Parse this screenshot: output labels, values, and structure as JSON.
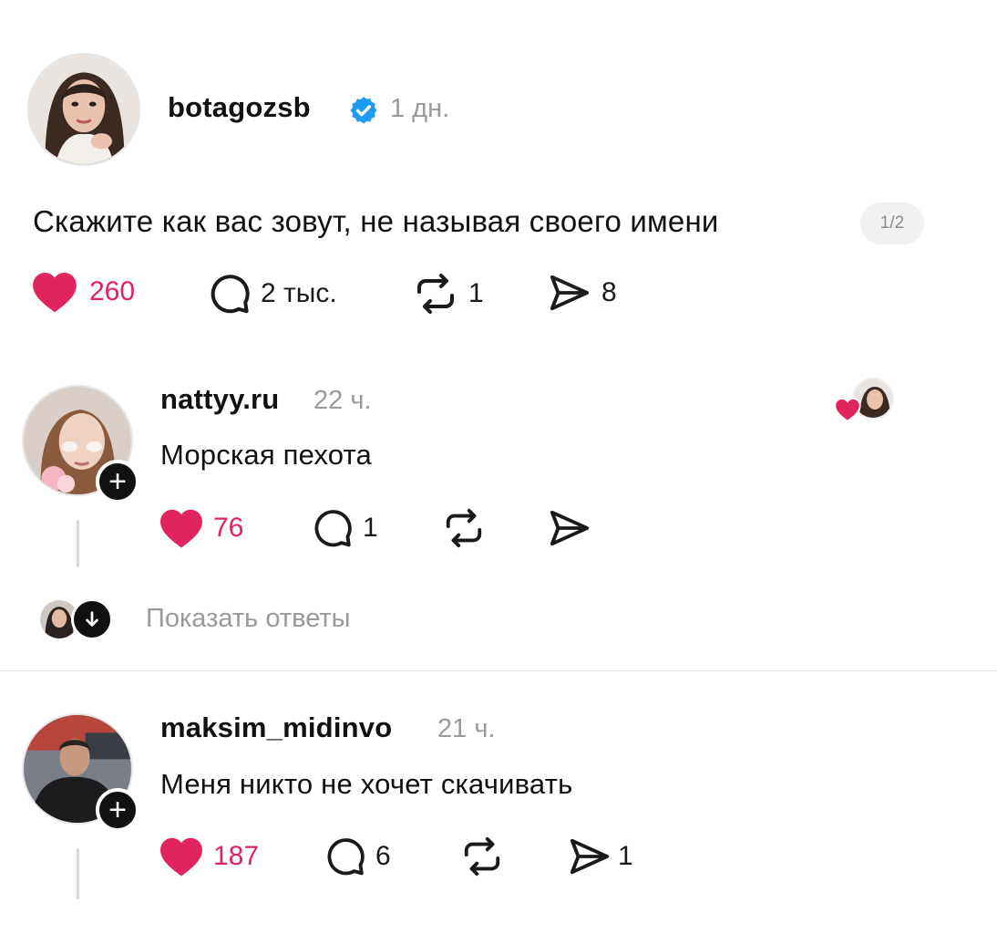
{
  "post": {
    "username": "botagozsb",
    "time": "1 дн.",
    "text": "Скажите как вас зовут, не называя своего имени",
    "page_indicator": "1/2",
    "likes": "260",
    "comments": "2 тыс.",
    "reposts": "1",
    "shares": "8"
  },
  "comments": [
    {
      "username": "nattyy.ru",
      "time": "22 ч.",
      "text": "Морская пехота",
      "likes": "76",
      "replies": "1",
      "reposts": "",
      "shares": ""
    },
    {
      "username": "maksim_midinvo",
      "time": "21 ч.",
      "text": "Меня никто не хочет скачивать",
      "likes": "187",
      "replies": "6",
      "reposts": "",
      "shares": "1"
    }
  ],
  "show_replies_label": "Показать ответы",
  "icons": {
    "like": "heart-icon",
    "comment": "comment-bubble-icon",
    "repost": "repost-icon",
    "share": "send-icon",
    "verified": "verified-badge-icon",
    "follow": "plus-icon",
    "expand": "arrow-down-icon"
  },
  "colors": {
    "like": "#e0245e",
    "verified": "#1d9bf0",
    "muted_text": "#9a9a9a"
  }
}
